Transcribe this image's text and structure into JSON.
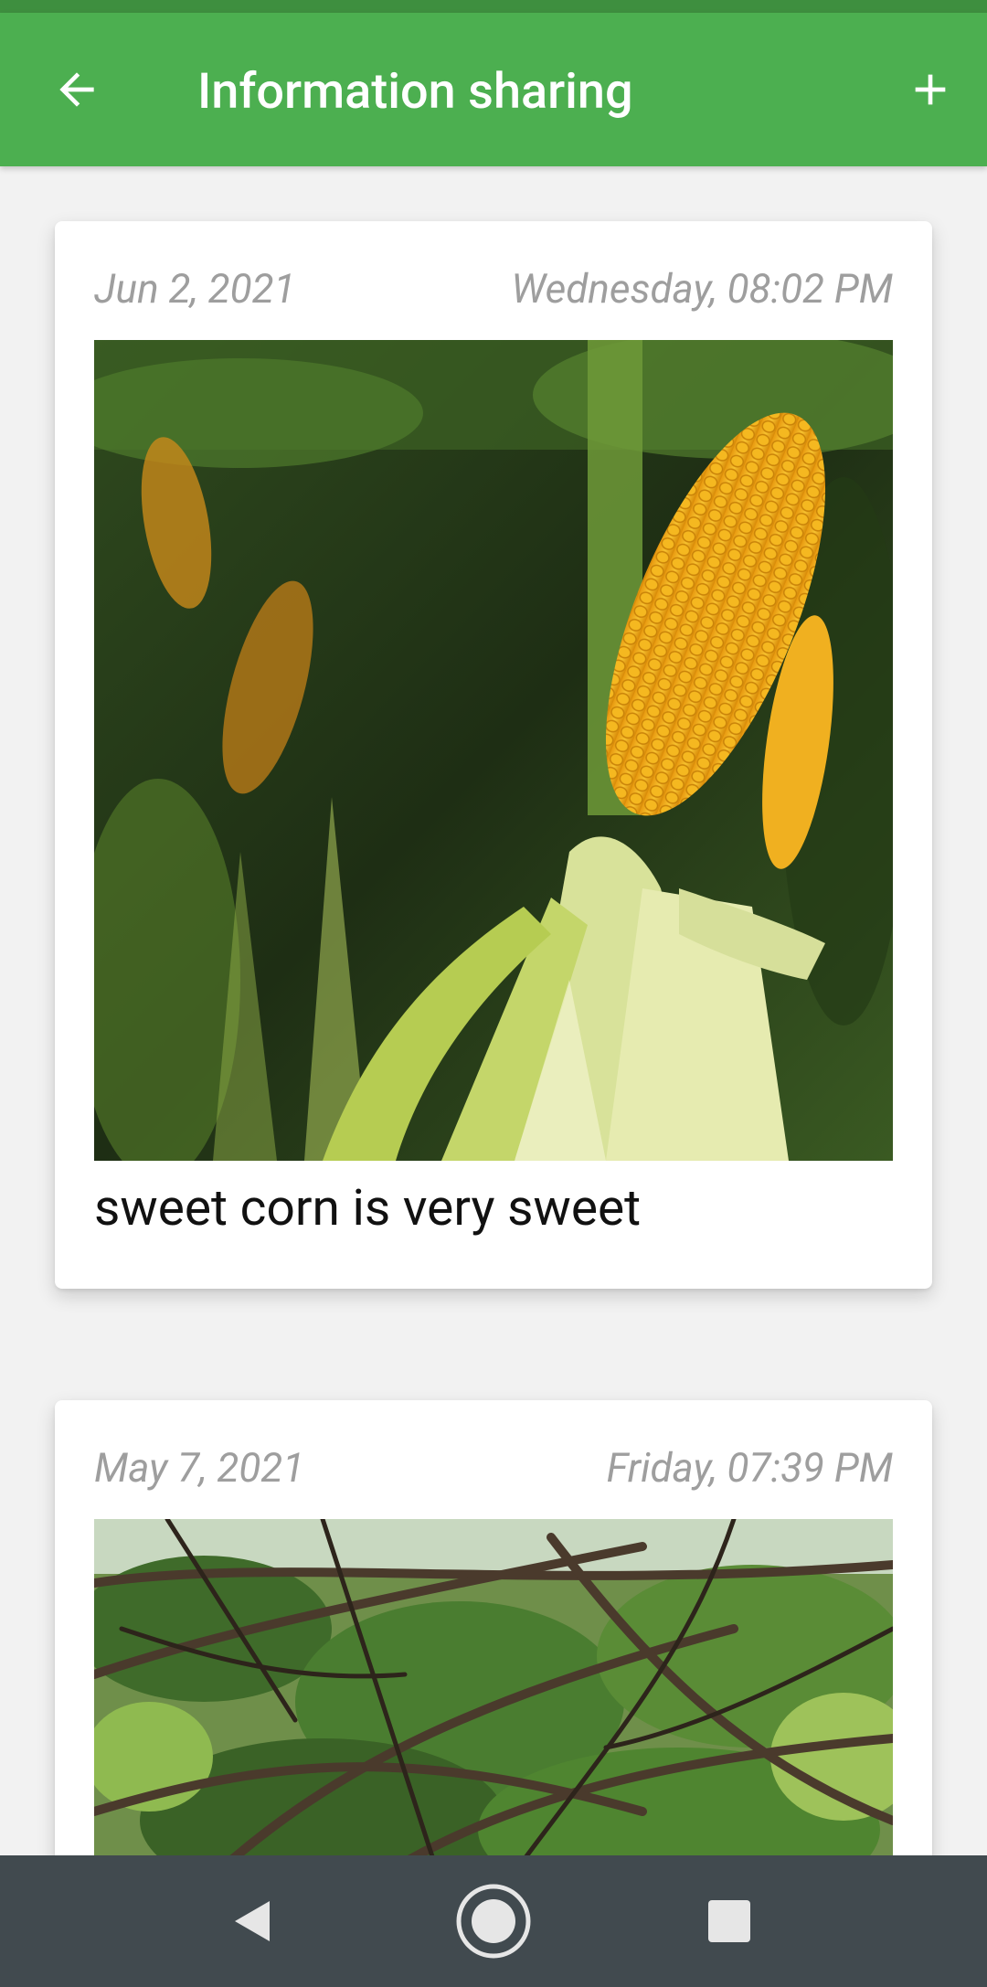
{
  "app_bar": {
    "title": "Information sharing",
    "back_icon": "arrow-back-icon",
    "add_icon": "plus-icon",
    "color": "#4caf50"
  },
  "posts": [
    {
      "date": "Jun 2, 2021",
      "day_time": "Wednesday, 08:02 PM",
      "image": "corn-photo",
      "caption": "sweet corn is very sweet"
    },
    {
      "date": "May 7, 2021",
      "day_time": "Friday, 07:39 PM",
      "image": "tree-branches-photo"
    }
  ],
  "nav_bar": {
    "back_icon": "triangle-back-icon",
    "home_icon": "circle-home-icon",
    "recents_icon": "square-recents-icon"
  }
}
